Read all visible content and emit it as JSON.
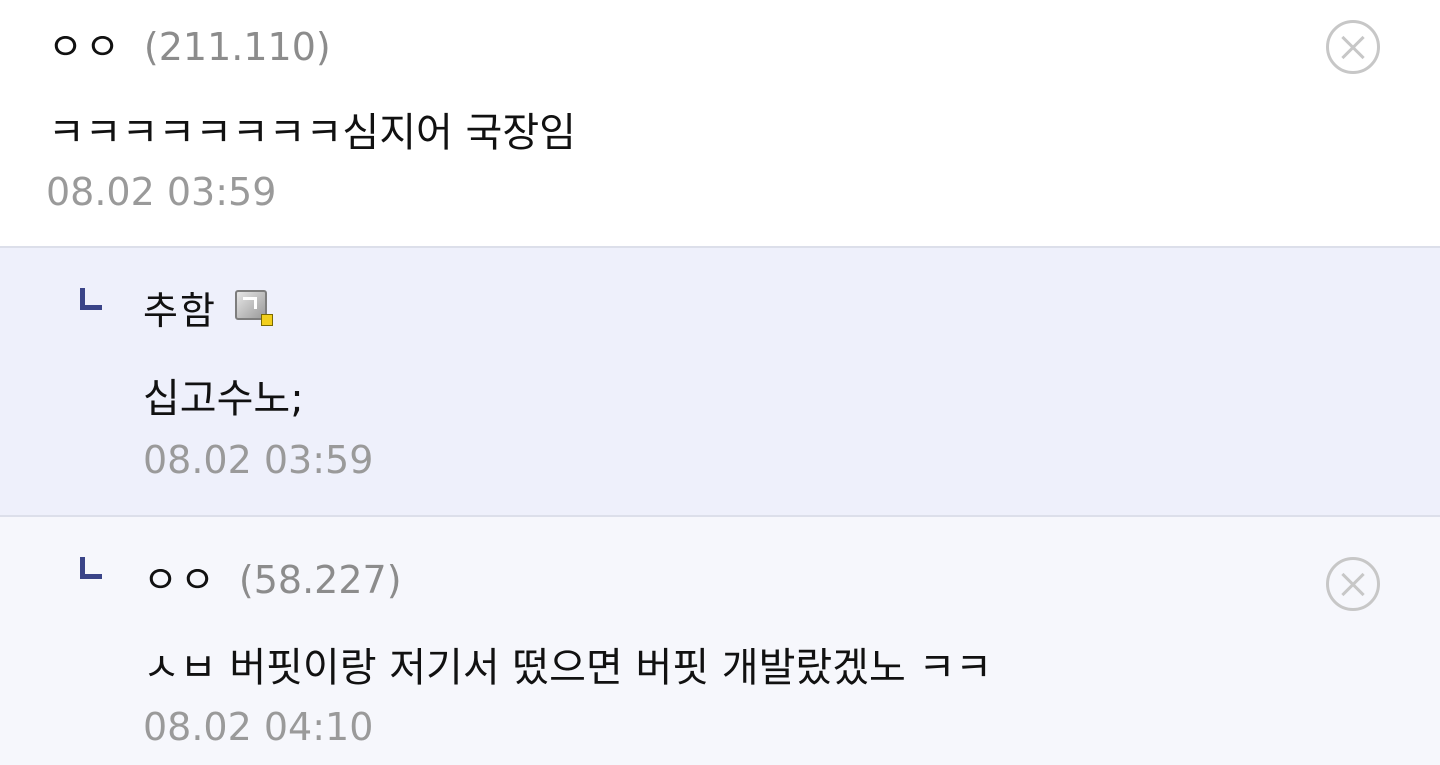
{
  "comments": [
    {
      "nickname": "ㅇㅇ",
      "ip": "(211.110)",
      "text": "ㅋㅋㅋㅋㅋㅋㅋㅋ심지어 국장임",
      "time": "08.02 03:59"
    },
    {
      "nickname": "추함",
      "text": "십고수노;",
      "time": "08.02 03:59",
      "badge_icon": "fixed-nickname-icon"
    },
    {
      "nickname": "ㅇㅇ",
      "ip": "(58.227)",
      "text": "ㅅㅂ 버핏이랑 저기서 떴으면 버핏 개발랐겠노 ㅋㅋ",
      "time": "08.02 04:10"
    }
  ],
  "icons": {
    "delete": "close-circle-icon",
    "reply": "reply-arrow-icon"
  },
  "colors": {
    "reply_background": "#eef0fb",
    "reply_marker": "#3a4488",
    "muted_text": "#9a9a9a"
  }
}
